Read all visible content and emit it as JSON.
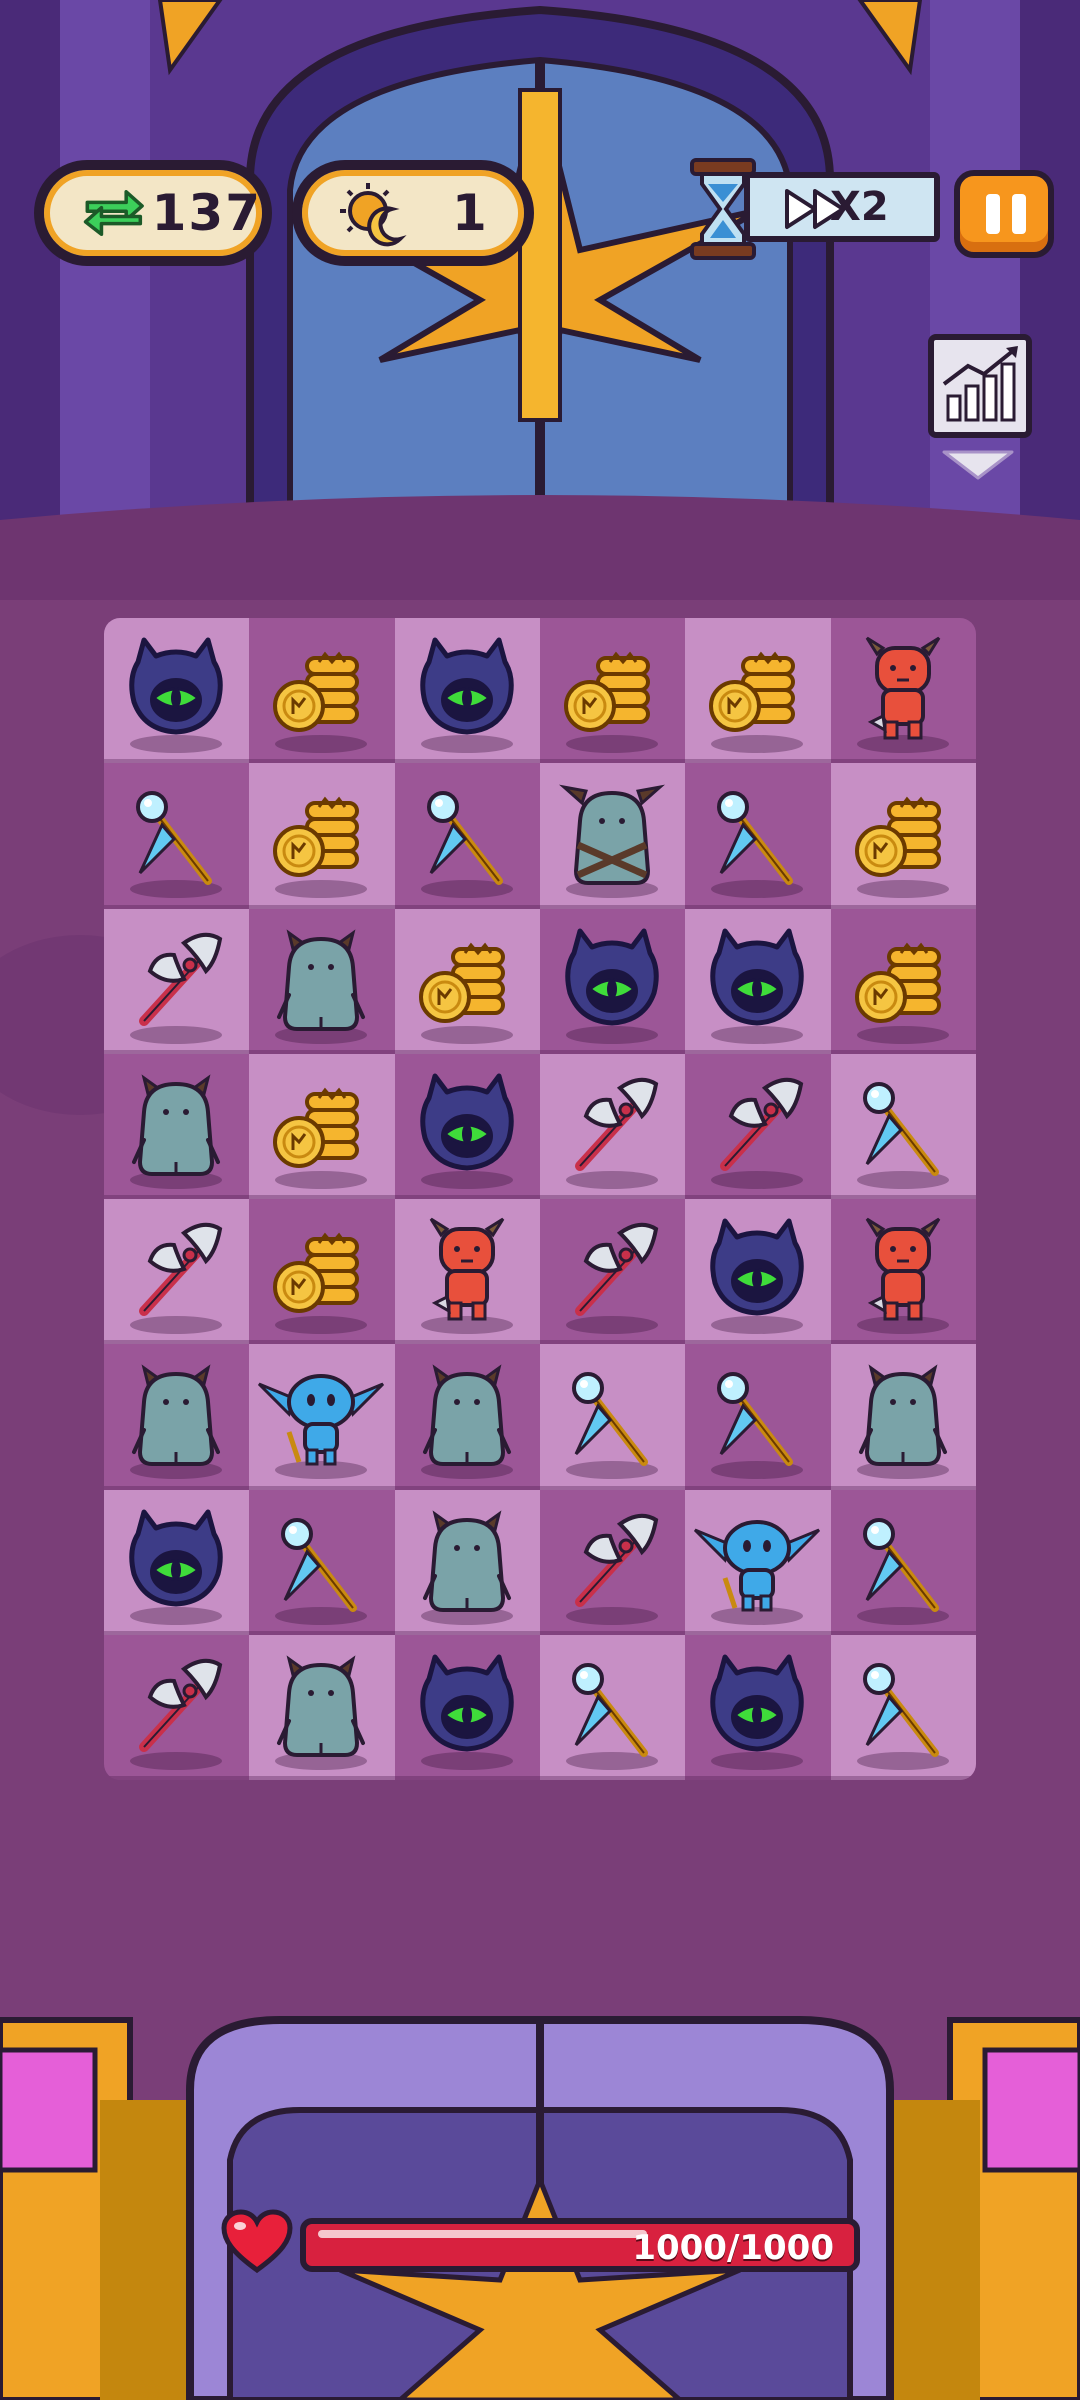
{
  "hud": {
    "moves": {
      "icon": "swap-arrows-icon",
      "value": "137"
    },
    "wave": {
      "icon": "sun-moon-icon",
      "value": "1"
    },
    "speed": {
      "icon": "hourglass-icon",
      "label": "X2"
    },
    "pause": {
      "icon": "pause-icon"
    },
    "stats": {
      "icon": "bar-chart-icon"
    }
  },
  "board": {
    "columns": 6,
    "rows": 8,
    "cells": [
      [
        "hooded-eye",
        "coin-stack",
        "hooded-eye",
        "coin-stack",
        "coin-stack",
        "red-demon"
      ],
      [
        "magic-staff",
        "coin-stack",
        "magic-staff",
        "horned-ogre",
        "magic-staff",
        "coin-stack"
      ],
      [
        "battle-axe",
        "gray-ogre",
        "coin-stack",
        "hooded-eye",
        "hooded-eye",
        "coin-stack"
      ],
      [
        "gray-ogre",
        "coin-stack",
        "hooded-eye",
        "battle-axe",
        "battle-axe",
        "magic-staff"
      ],
      [
        "battle-axe",
        "coin-stack",
        "red-demon",
        "battle-axe",
        "hooded-eye",
        "red-demon"
      ],
      [
        "gray-ogre",
        "blue-goblin",
        "gray-ogre",
        "magic-staff",
        "magic-staff",
        "gray-ogre"
      ],
      [
        "hooded-eye",
        "magic-staff",
        "gray-ogre",
        "battle-axe",
        "blue-goblin",
        "magic-staff"
      ],
      [
        "battle-axe",
        "gray-ogre",
        "hooded-eye",
        "magic-staff",
        "hooded-eye",
        "magic-staff"
      ]
    ]
  },
  "health": {
    "icon": "heart-icon",
    "text": "1000/1000",
    "current": 1000,
    "max": 1000
  },
  "colors": {
    "background": "#7a3e78",
    "tile_light": "#c78fc5",
    "tile_dark": "#9c5697",
    "hp_fill": "#d8213f",
    "accent_orange": "#f7961d",
    "gold": "#f0a325"
  }
}
